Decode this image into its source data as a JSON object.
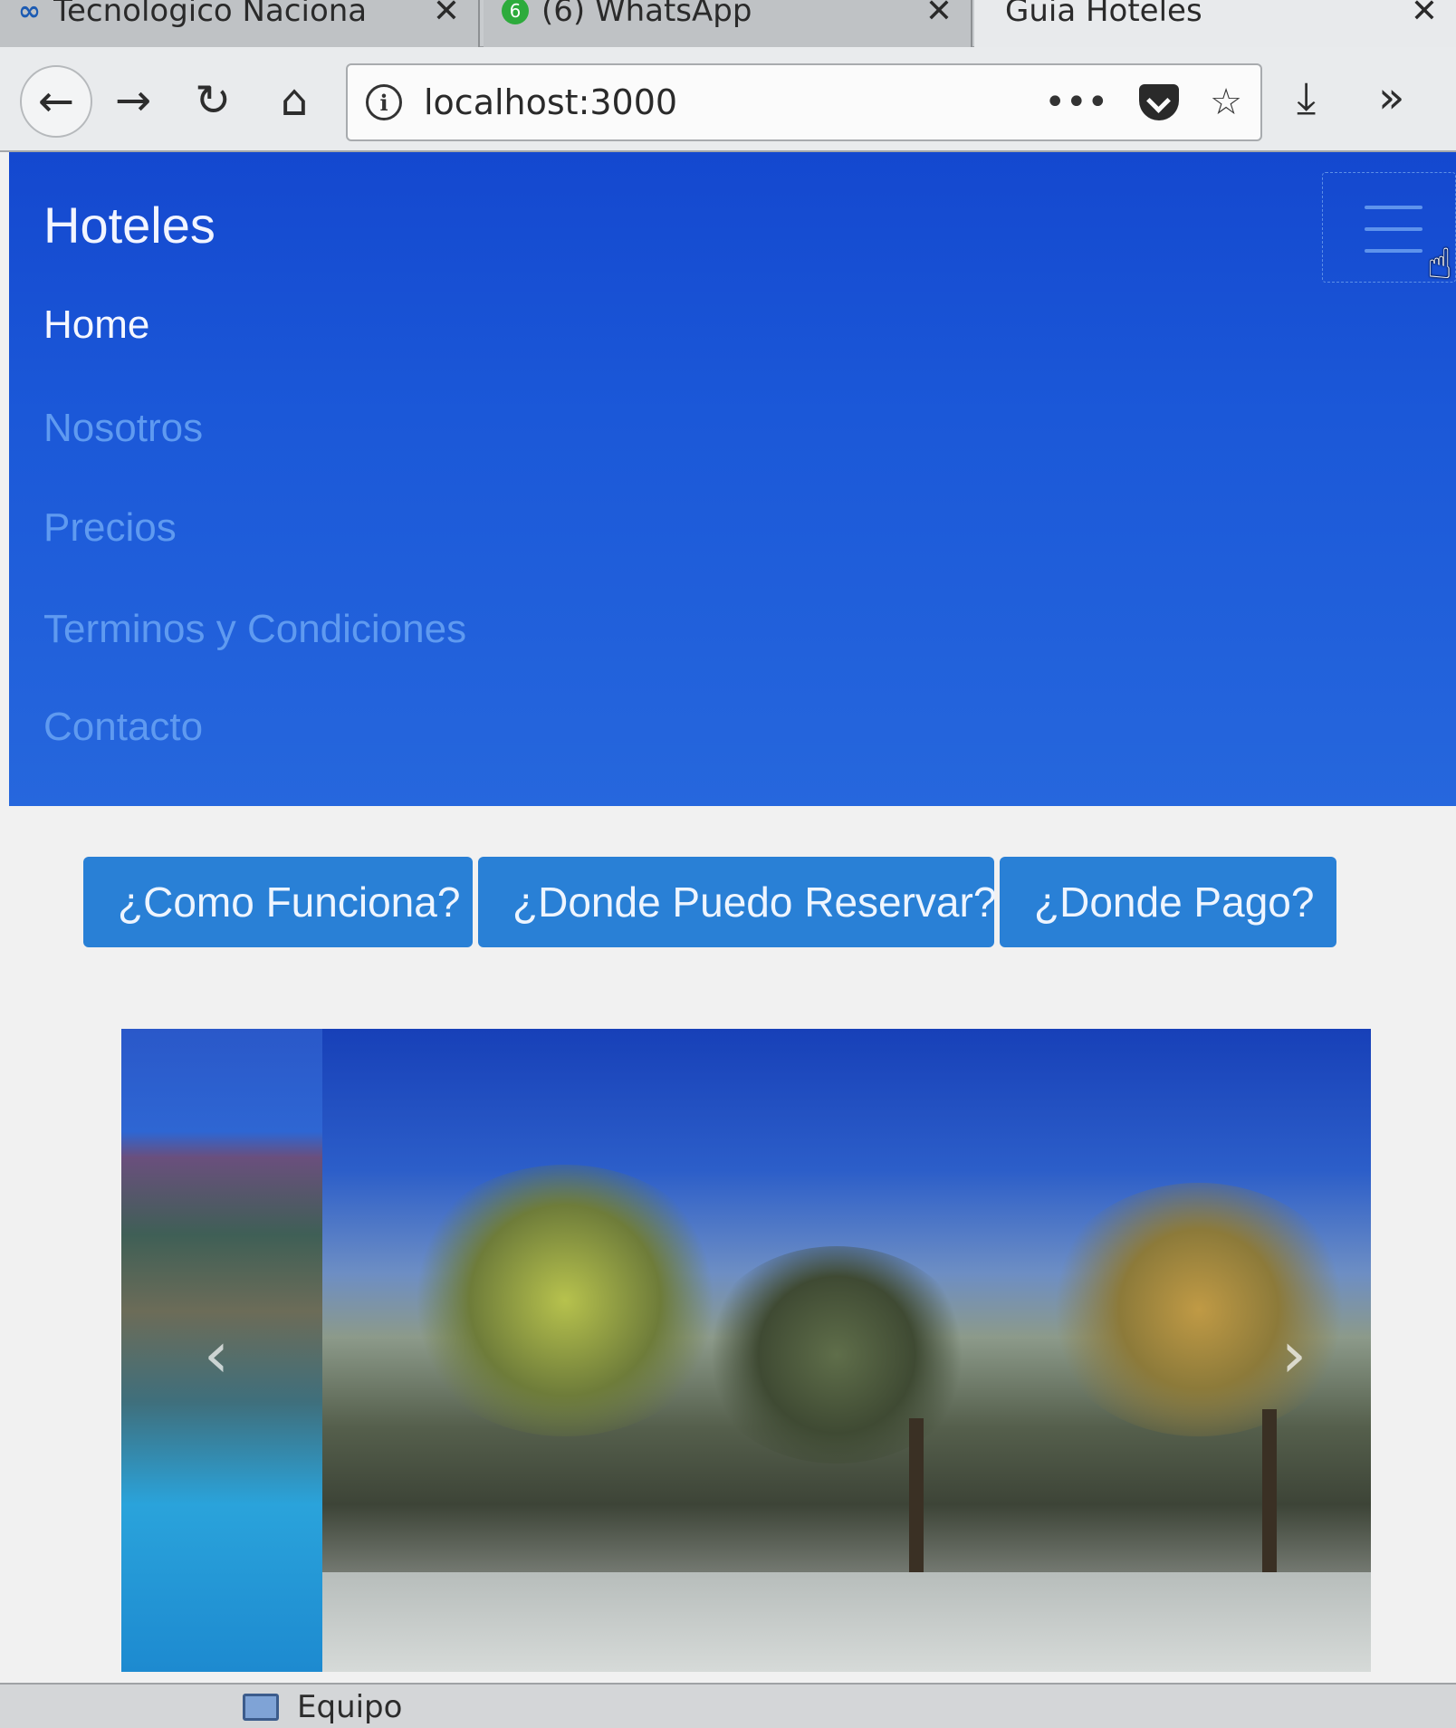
{
  "browser": {
    "tabs": [
      {
        "label": "Tecnologico Naciona",
        "favicon": "infinity-icon"
      },
      {
        "label": "(6) WhatsApp",
        "favicon": "whatsapp-icon",
        "badge": "6"
      },
      {
        "label": "Guia Hoteles",
        "active": true
      }
    ],
    "close_glyph": "✕",
    "url": "localhost:3000",
    "url_actions": {
      "more": "•••"
    },
    "glyphs": {
      "back": "←",
      "forward": "→",
      "reload": "↻",
      "home": "⌂",
      "star": "☆",
      "download": "⤓",
      "overflow": "»",
      "info": "i"
    }
  },
  "site": {
    "brand": "Hoteles",
    "menu": [
      {
        "label": "Home",
        "active": true
      },
      {
        "label": "Nosotros",
        "active": false
      },
      {
        "label": "Precios",
        "active": false
      },
      {
        "label": "Terminos y Condiciones",
        "active": false
      },
      {
        "label": "Contacto",
        "active": false
      }
    ],
    "buttons": [
      {
        "label": "¿Como Funciona?"
      },
      {
        "label": "¿Donde Puedo Reservar?"
      },
      {
        "label": "¿Donde Pago?"
      }
    ],
    "carousel": {
      "prev_glyph": "‹",
      "next_glyph": "›"
    }
  },
  "taskbar": {
    "item_label": "Equipo",
    "item_icon": "computer-icon"
  },
  "colors": {
    "navbar": "#1b58d8",
    "button": "#2980d6",
    "menu_inactive": "#5f9af0"
  }
}
